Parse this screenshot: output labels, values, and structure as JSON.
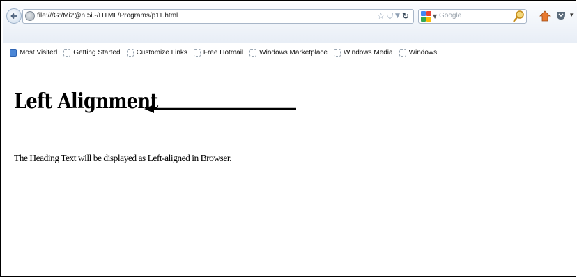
{
  "navbar": {
    "url": "file:///G:/Mi2@n 5i.-/HTML/Programs/p11.html",
    "search_placeholder": "Google",
    "icons": [
      "back-arrow-icon",
      "globe-icon",
      "star-icon",
      "bookmark-shield-icon",
      "dropdown-icon",
      "reload-icon",
      "google-icon",
      "search-icon",
      "home-icon",
      "pocket-icon"
    ]
  },
  "bookmarks": {
    "items": [
      {
        "label": "Most Visited",
        "icon": "most-visited-icon"
      },
      {
        "label": "Getting Started",
        "icon": "bookmark-page-icon"
      },
      {
        "label": "Customize Links",
        "icon": "bookmark-page-icon"
      },
      {
        "label": "Free Hotmail",
        "icon": "bookmark-page-icon"
      },
      {
        "label": "Windows Marketplace",
        "icon": "bookmark-page-icon"
      },
      {
        "label": "Windows Media",
        "icon": "bookmark-page-icon"
      },
      {
        "label": "Windows",
        "icon": "bookmark-page-icon"
      }
    ]
  },
  "page": {
    "heading": "Left Alignment",
    "paragraph": "The Heading Text will be displayed as Left-aligned in Browser."
  },
  "colors": {
    "accent_blue": "#2e63b1",
    "home_orange": "#e8792f",
    "google_blue": "#4285f4",
    "google_red": "#ea4335",
    "google_yellow": "#fbbc05",
    "google_green": "#34a853"
  }
}
